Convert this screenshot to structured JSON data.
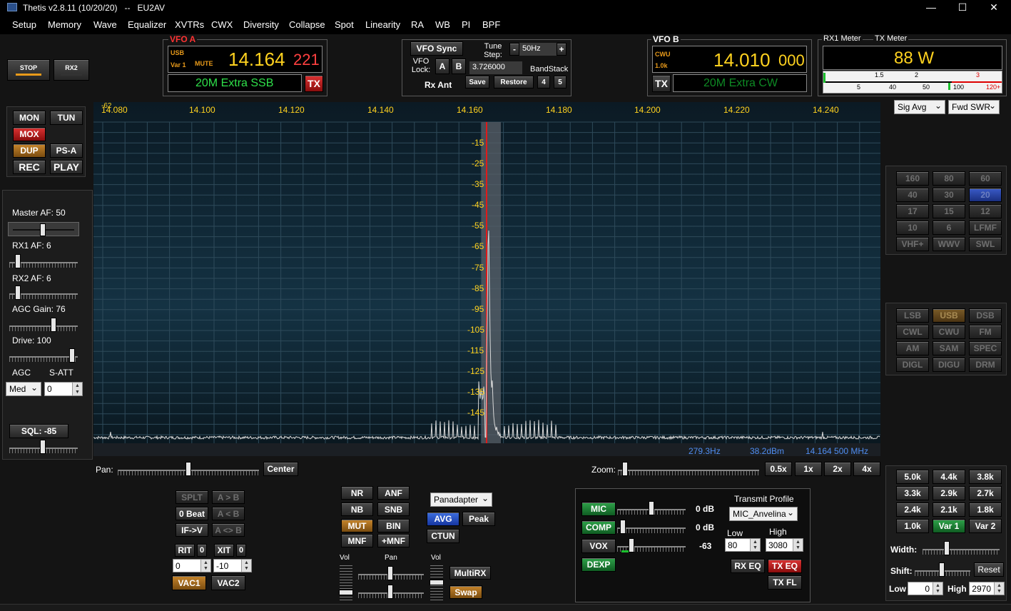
{
  "titlebar": {
    "title": "Thetis v2.8.11 (10/20/20)   --   EU2AV",
    "minimize": "—",
    "maximize": "☐",
    "close": "✕"
  },
  "menu": [
    "Setup",
    "Memory",
    "Wave",
    "Equalizer",
    "XVTRs",
    "CWX",
    "Diversity",
    "Collapse",
    "Spot",
    "Linearity",
    "RA",
    "WB",
    "PI",
    "BPF"
  ],
  "top_left": {
    "stop": "STOP",
    "rx2": "RX2"
  },
  "vfo_a": {
    "label": "VFO A",
    "mode": "USB",
    "var": "Var 1",
    "mute": "MUTE",
    "freq_main": "14.164",
    "freq_sub": "221",
    "band": "20M Extra SSB",
    "tx": "TX"
  },
  "vfo_sync": {
    "sync": "VFO Sync",
    "tune_step_label": "Tune Step:",
    "tune_step_minus": "-",
    "tune_step_value": "50Hz",
    "tune_step_plus": "+",
    "vfo_lock": "VFO Lock:",
    "a": "A",
    "b": "B",
    "freq_field": "3.726000",
    "bandstack": "BandStack",
    "rx_ant": "Rx Ant",
    "save": "Save",
    "restore": "Restore",
    "bs4": "4",
    "bs5": "5"
  },
  "vfo_b": {
    "label": "VFO B",
    "mode": "CWU",
    "var": "1.0k",
    "freq_main": "14.010",
    "freq_sub": "000",
    "band": "20M Extra CW",
    "tx": "TX"
  },
  "meter": {
    "rx1": "RX1 Meter",
    "tx": "TX Meter",
    "value": "88 W",
    "scale": [
      "5",
      "40",
      "50",
      "100",
      "120+"
    ],
    "scale_top": [
      "1.5",
      "2",
      "3"
    ],
    "sig": "Sig Avg",
    "fwd": "Fwd SWR"
  },
  "left_buttons": {
    "mon": "MON",
    "tun": "TUN",
    "mox": "MOX",
    "dup": "DUP",
    "psa": "PS-A",
    "rec": "REC",
    "play": "PLAY"
  },
  "audio": {
    "master": "Master AF:  50",
    "rx1": "RX1 AF:  6",
    "rx2": "RX2 AF:  6",
    "agc_gain": "AGC Gain:  76",
    "drive": "Drive:  100",
    "agc": "AGC",
    "satt": "S-ATT",
    "agc_value": "Med",
    "satt_value": "0",
    "sql": "SQL: -85"
  },
  "spectrum": {
    "freqs": [
      "14.080",
      "14.100",
      "14.120",
      "14.140",
      "14.160",
      "14.180",
      "14.200",
      "14.220",
      "14.240"
    ],
    "corner": "-62",
    "dbs": [
      "-15",
      "-25",
      "-35",
      "-45",
      "-55",
      "-65",
      "-75",
      "-85",
      "-95",
      "-105",
      "-115",
      "-125",
      "-135",
      "-145"
    ],
    "status": {
      "hz": "279.3Hz",
      "dbm": "38.2dBm",
      "freq": "14.164 500 MHz"
    }
  },
  "pan": {
    "pan": "Pan:",
    "center": "Center",
    "zoom": "Zoom:",
    "z05": "0.5x",
    "z1": "1x",
    "z2": "2x",
    "z4": "4x"
  },
  "bands": [
    "160",
    "80",
    "60",
    "40",
    "30",
    "20",
    "17",
    "15",
    "12",
    "10",
    "6",
    "LFMF",
    "VHF+",
    "WWV",
    "SWL"
  ],
  "modes": [
    "LSB",
    "USB",
    "DSB",
    "CWL",
    "CWU",
    "FM",
    "AM",
    "SAM",
    "SPEC",
    "DIGL",
    "DIGU",
    "DRM"
  ],
  "filters": [
    "5.0k",
    "4.4k",
    "3.8k",
    "3.3k",
    "2.9k",
    "2.7k",
    "2.4k",
    "2.1k",
    "1.8k",
    "1.0k",
    "Var 1",
    "Var 2"
  ],
  "filter_ctrl": {
    "width": "Width:",
    "shift": "Shift:",
    "reset": "Reset",
    "low": "Low",
    "low_val": "0",
    "high": "High",
    "high_val": "2970"
  },
  "rit": {
    "splt": "SPLT",
    "ab": "A > B",
    "zerobeat": "0 Beat",
    "ba": "A < B",
    "ifv": "IF->V",
    "swap": "A <> B",
    "rit": "RIT",
    "rit_on": "0",
    "xit": "XIT",
    "xit_on": "0",
    "rit_val": "0",
    "xit_val": "-10",
    "vac1": "VAC1",
    "vac2": "VAC2"
  },
  "dsp": {
    "nr": "NR",
    "anf": "ANF",
    "nb": "NB",
    "snb": "SNB",
    "mut": "MUT",
    "bin": "BIN",
    "mnf": "MNF",
    "pmnf": "+MNF",
    "vol": "Vol",
    "pan": "Pan",
    "vol2": "Vol",
    "multirx": "MultiRX",
    "swap": "Swap"
  },
  "display": {
    "mode": "Panadapter",
    "avg": "AVG",
    "peak": "Peak",
    "ctun": "CTUN"
  },
  "tx": {
    "mic": "MIC",
    "comp": "COMP",
    "vox": "VOX",
    "dexp": "DEXP",
    "mic_db": "0 dB",
    "comp_db": "0 dB",
    "vox_val": "-63",
    "profile_label": "Transmit Profile",
    "profile": "MIC_Anvelina",
    "low": "Low",
    "high": "High",
    "low_val": "80",
    "high_val": "3080",
    "rxeq": "RX EQ",
    "txeq": "TX EQ",
    "txfl": "TX FL"
  }
}
